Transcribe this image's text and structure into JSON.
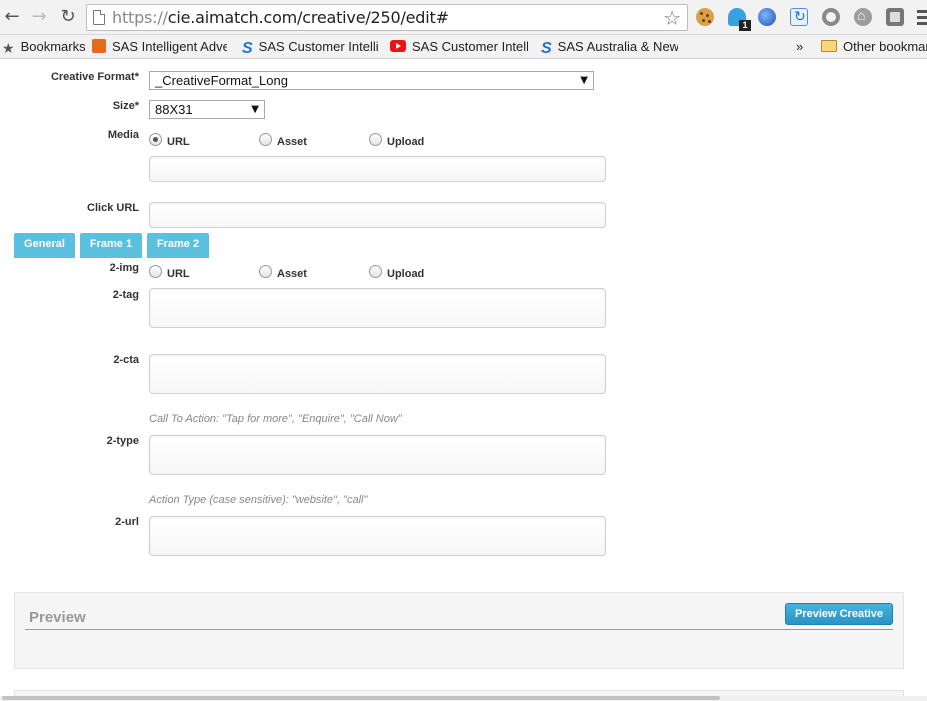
{
  "browser": {
    "url_scheme": "https://",
    "url_rest": "cie.aimatch.com/creative/250/edit#",
    "extensions": [
      "cookie-icon",
      "ghost-icon",
      "globe-icon",
      "refresh-icon",
      "ring-icon",
      "home-icon",
      "square-icon"
    ],
    "ghost_badge": "1"
  },
  "bookmarks": {
    "bar_label": "Bookmarks",
    "items": [
      "SAS Intelligent Advert",
      "SAS Customer Intellig",
      "SAS Customer Intellig",
      "SAS Australia & New Z"
    ],
    "overflow": "»",
    "other": "Other bookmarks"
  },
  "form": {
    "creative_format": {
      "label": "Creative Format*",
      "value": "_CreativeFormat_Long"
    },
    "size": {
      "label": "Size*",
      "value": "88X31"
    },
    "media": {
      "label": "Media",
      "options": [
        "URL",
        "Asset",
        "Upload"
      ],
      "selected": "URL",
      "value": ""
    },
    "click_url": {
      "label": "Click URL",
      "value": ""
    },
    "tabs": [
      "General",
      "Frame 1",
      "Frame 2"
    ],
    "active_tab": "Frame 2",
    "img": {
      "label": "2-img",
      "options": [
        "URL",
        "Asset",
        "Upload"
      ],
      "selected": ""
    },
    "tag": {
      "label": "2-tag",
      "value": ""
    },
    "cta": {
      "label": "2-cta",
      "value": "",
      "hint": "Call To Action: \"Tap for more\", \"Enquire\", \"Call Now\""
    },
    "type": {
      "label": "2-type",
      "value": "",
      "hint": "Action Type (case sensitive): \"website\", \"call\""
    },
    "url": {
      "label": "2-url",
      "value": ""
    }
  },
  "preview": {
    "title": "Preview",
    "button": "Preview Creative"
  },
  "colors": {
    "tab": "#5bc0de",
    "button": "#2a93c4"
  }
}
